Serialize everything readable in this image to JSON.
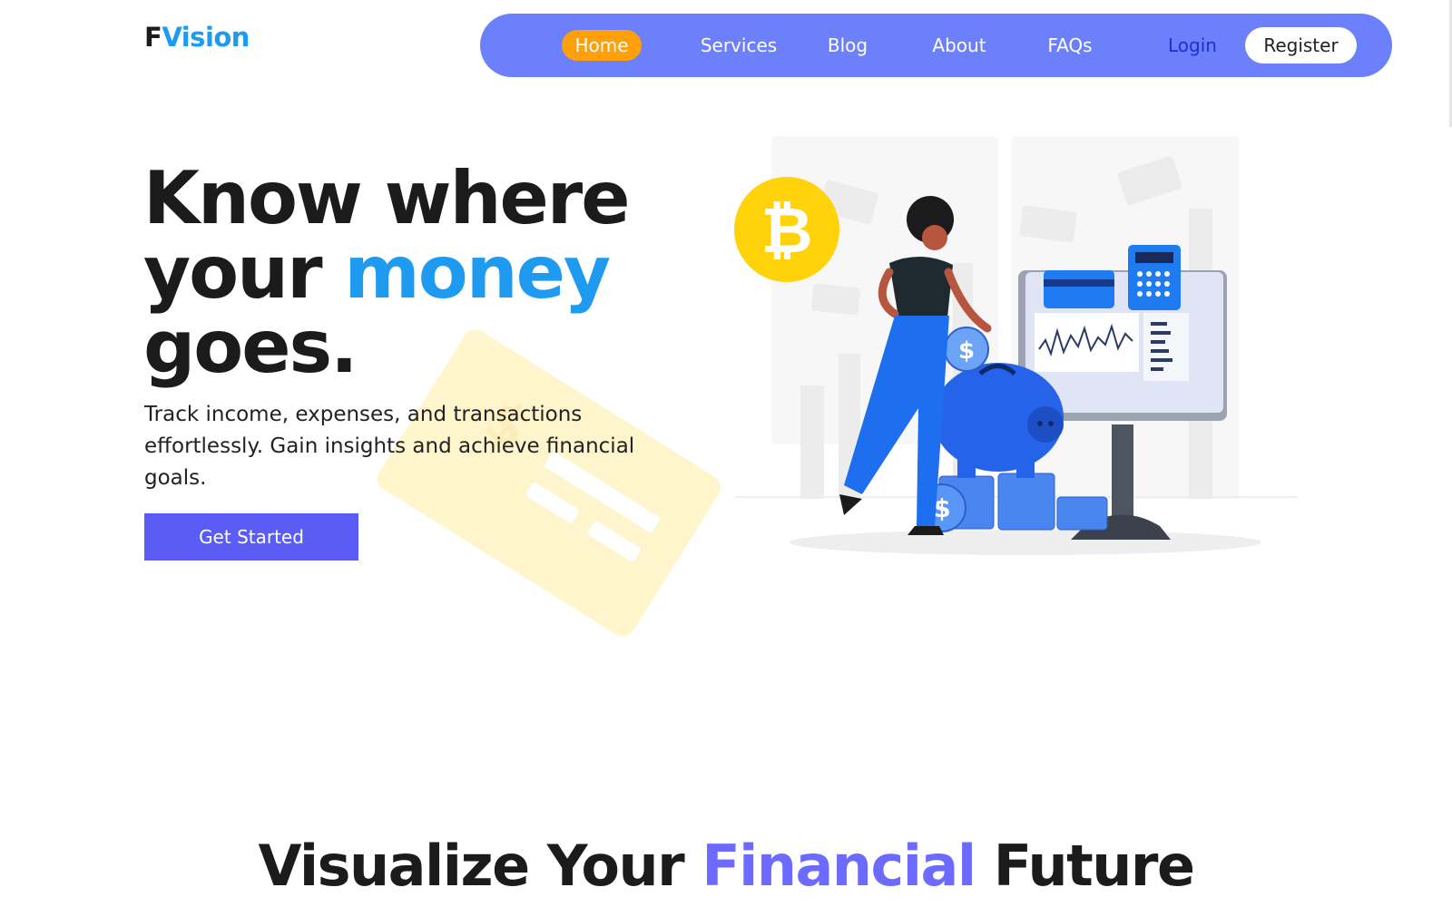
{
  "brand": {
    "part1": "F",
    "part2": "Vision"
  },
  "nav": {
    "home": "Home",
    "services": "Services",
    "blog": "Blog",
    "about": "About",
    "faqs": "FAQs",
    "login": "Login",
    "register": "Register"
  },
  "hero": {
    "title_line1": "Know where",
    "title_line2_a": "your ",
    "title_line2_b": "money",
    "title_line3": "goes.",
    "subtitle": "Track income, expenses, and transactions effortlessly. Gain insights and achieve financial goals.",
    "cta": "Get Started"
  },
  "illustration": {
    "coin_symbol": "₿",
    "dollar_symbol": "$"
  },
  "section": {
    "title_a": "Visualize Your ",
    "title_b": "Financial",
    "title_c": " Future"
  },
  "colors": {
    "brand_blue": "#1e9bf0",
    "nav_bg": "#6d80fb",
    "nav_active": "#ff9f0a",
    "cta": "#5a5cf5",
    "section_accent": "#6d6bff"
  }
}
